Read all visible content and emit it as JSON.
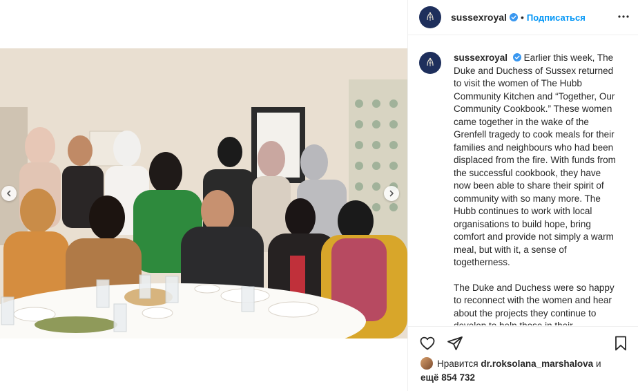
{
  "header": {
    "username": "sussexroyal",
    "follow_label": "Подписаться",
    "separator": "•"
  },
  "caption": {
    "username": "sussexroyal",
    "paragraph1": "Earlier this week, The Duke and Duchess of Sussex returned to visit the women of The Hubb Community Kitchen and “Together, Our Community Cookbook.” These women came together in the wake of the Grenfell tragedy to cook meals for their families and neighbours who had been displaced from the fire. With funds from the successful cookbook, they have now been able to share their spirit of community with so many more. The Hubb continues to work with local organisations to build hope, bring comfort and provide not simply a warm meal, but with it, a sense of togetherness.",
    "paragraph2": "The Duke and Duchess were so happy to reconnect with the women and hear about the projects they continue to develop to help those in their"
  },
  "likes": {
    "prefix": "Нравится",
    "liker": "dr.roksolana_marshalova",
    "conj": "и",
    "more_prefix": "ещё",
    "count": "854 732"
  },
  "icons": {
    "verified": "verified-badge-icon",
    "like": "heart-icon",
    "share": "paper-plane-icon",
    "save": "bookmark-icon",
    "more": "more-options-icon",
    "prev": "chevron-left-icon",
    "next": "chevron-right-icon"
  },
  "colors": {
    "link": "#0095f6",
    "verified": "#3897f0",
    "avatar_bg": "#1e2f5c",
    "text": "#262626"
  }
}
